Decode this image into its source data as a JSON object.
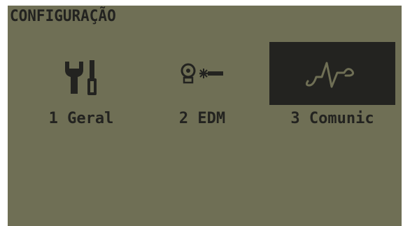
{
  "screen": {
    "title": "CONFIGURAÇÃO",
    "background_color": "#6f6f55",
    "foreground_color": "#232320"
  },
  "menu": {
    "selected_index": 2,
    "items": [
      {
        "label": "1 Geral",
        "icon": "tools-icon",
        "selected": false
      },
      {
        "label": "2 EDM",
        "icon": "edm-laser-icon",
        "selected": false
      },
      {
        "label": "3 Comunic",
        "icon": "communication-signal-icon",
        "selected": true
      }
    ]
  }
}
